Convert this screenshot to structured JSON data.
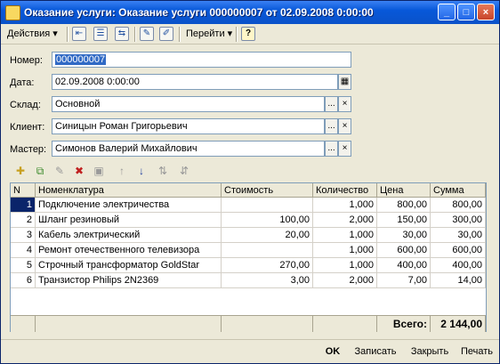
{
  "window": {
    "title": "Оказание услуги: Оказание услуги 000000007 от 02.09.2008 0:00:00",
    "minimize": "_",
    "maximize": "□",
    "close": "×"
  },
  "toolbar": {
    "actions_label": "Действия",
    "goto_label": "Перейти",
    "help": "?"
  },
  "form": {
    "number": {
      "label": "Номер:",
      "value": "000000007"
    },
    "date": {
      "label": "Дата:",
      "value": "02.09.2008  0:00:00"
    },
    "warehouse": {
      "label": "Склад:",
      "value": "Основной"
    },
    "client": {
      "label": "Клиент:",
      "value": "Синицын Роман Григорьевич"
    },
    "master": {
      "label": "Мастер:",
      "value": "Симонов Валерий Михайлович"
    }
  },
  "buttons": {
    "select": "...",
    "clear": "×"
  },
  "table": {
    "columns": [
      "N",
      "Номенклатура",
      "Стоимость",
      "Количество",
      "Цена",
      "Сумма"
    ],
    "rows": [
      [
        "1",
        "Подключение электричества",
        "",
        "1,000",
        "800,00",
        "800,00"
      ],
      [
        "2",
        "Шланг резиновый",
        "100,00",
        "2,000",
        "150,00",
        "300,00"
      ],
      [
        "3",
        "Кабель электрический",
        "20,00",
        "1,000",
        "30,00",
        "30,00"
      ],
      [
        "4",
        "Ремонт отечественного телевизора",
        "",
        "1,000",
        "600,00",
        "600,00"
      ],
      [
        "5",
        "Строчный трансформатор GoldStar",
        "270,00",
        "1,000",
        "400,00",
        "400,00"
      ],
      [
        "6",
        "Транзистор Philips 2N2369",
        "3,00",
        "2,000",
        "7,00",
        "14,00"
      ]
    ],
    "total_label": "Всего:",
    "total_value": "2 144,00"
  },
  "bottom": {
    "ok": "OK",
    "save": "Записать",
    "close": "Закрыть",
    "print": "Печать"
  },
  "colors": {
    "title_bar": "#0858d9",
    "selection": "#316ac5"
  }
}
